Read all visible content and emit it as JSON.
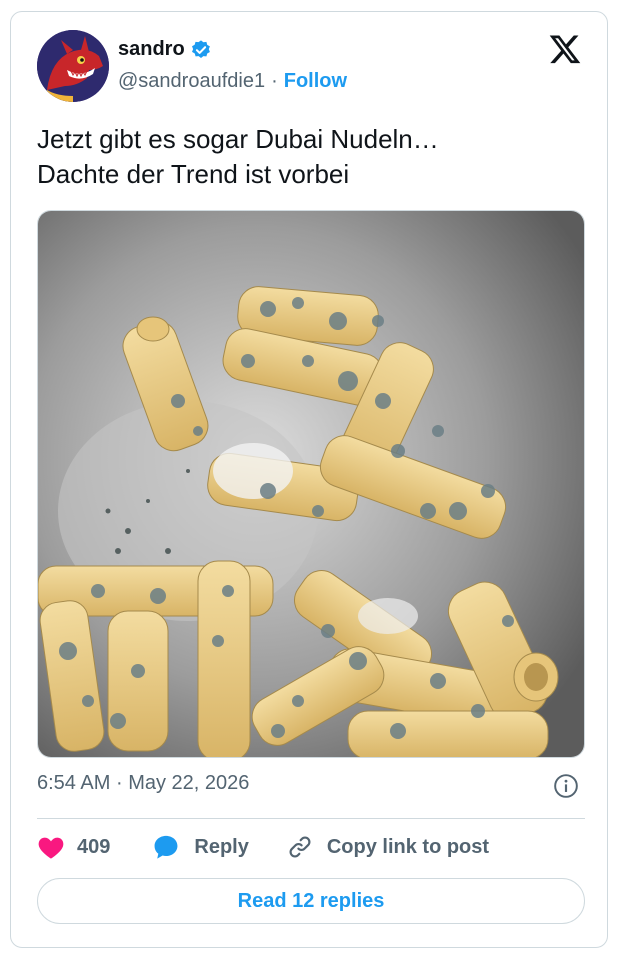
{
  "author": {
    "name": "sandro",
    "handle": "@sandroaufdie1",
    "separator": "·",
    "follow_label": "Follow",
    "verified": true,
    "avatar_icon": "dragon-avatar"
  },
  "tweet": {
    "text_line1": "Jetzt gibt es sogar Dubai Nudeln…",
    "text_line2": "Dachte der Trend ist vorbei",
    "media_description_icon": "moldy-pasta-photo"
  },
  "meta": {
    "time": "6:54 AM",
    "separator": "·",
    "date": "May 22, 2026"
  },
  "actions": {
    "like_count": "409",
    "reply_label": "Reply",
    "copy_label": "Copy link to post"
  },
  "read_replies_label": "Read 12 replies",
  "colors": {
    "accent": "#1d9bf0",
    "like": "#f91880",
    "text": "#0f1419",
    "muted": "#536471",
    "border": "#cfd9de"
  }
}
